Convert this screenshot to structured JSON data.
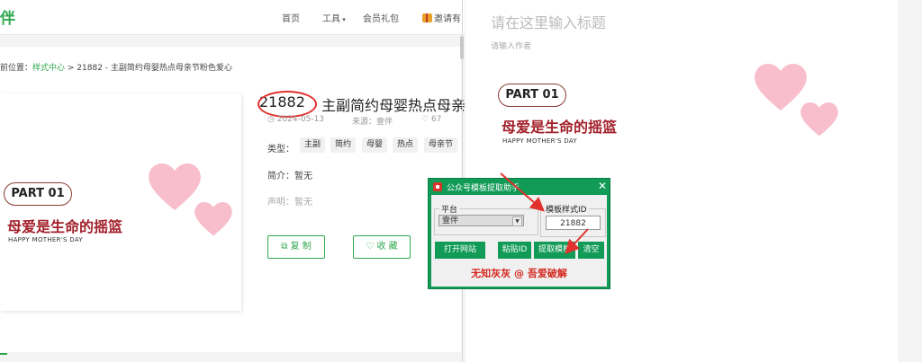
{
  "site": {
    "logo": "伴",
    "nav": [
      "首页",
      "工具",
      "会员礼包",
      "邀请有"
    ],
    "breadcrumb": {
      "prefix": "前位置：",
      "link": "样式中心",
      "rest": " > 21882 - 主副简约母婴热点母亲节粉色爱心"
    }
  },
  "preview": {
    "part_label": "PART 01",
    "slogan": "母爱是生命的摇篮",
    "subtitle": "HAPPY MOTHER'S DAY"
  },
  "template": {
    "id": "21882",
    "title": "主副简约母婴热点母亲",
    "date": "2024-05-13",
    "source_label": "来源：",
    "source": "壹伴",
    "likes": "67",
    "type_label": "类型：",
    "tags": [
      "主副",
      "简约",
      "母婴",
      "热点",
      "母亲节"
    ],
    "intro_label": "简介：",
    "intro": "暂无",
    "notice_label": "声明：",
    "notice": "暂无",
    "copy_button": "复 制",
    "favorite_button": "收 藏"
  },
  "editor": {
    "title_placeholder": "请在这里输入标题",
    "author_placeholder": "请输入作者",
    "part_label": "PART 01",
    "slogan": "母爱是生命的摇篮",
    "subtitle": "HAPPY MOTHER'S DAY"
  },
  "dialog": {
    "title": "公众号模板提取助手",
    "close": "✕",
    "platform_label": "平台",
    "platform_value": "壹伴",
    "template_id_label": "模板样式ID",
    "template_id_value": "21882",
    "buttons": {
      "open_site": "打开网站",
      "paste_id": "粘贴ID",
      "extract": "提取模板",
      "clear": "清空"
    },
    "credit": "无知灰灰 @ 吾爱破解"
  },
  "colors": {
    "brand_green": "#2fa84f",
    "dialog_green": "#119b57",
    "highlight_red": "#e0312d",
    "slogan_red": "#a2202a",
    "heart_pink": "#f4a7b9"
  },
  "icons": [
    "gift-icon",
    "clock-icon",
    "heart-icon",
    "copy-icon",
    "heart-outline-icon",
    "app-icon",
    "close-icon",
    "chevron-down-icon"
  ]
}
